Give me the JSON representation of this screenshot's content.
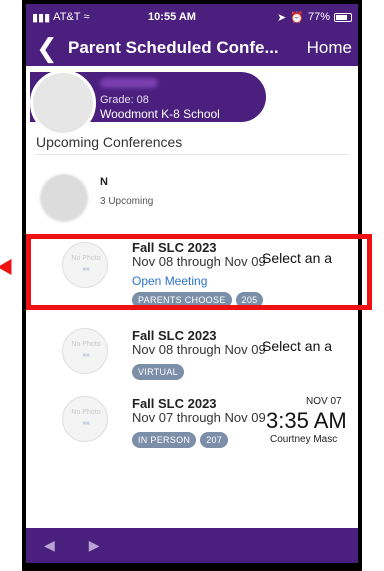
{
  "status_bar": {
    "carrier": "AT&T",
    "time": "10:55 AM",
    "battery": "77%"
  },
  "nav": {
    "title": "Parent Scheduled Confe...",
    "home_label": "Home"
  },
  "student": {
    "grade": "Grade: 08",
    "school": "Woodmont K-8 School"
  },
  "section": {
    "title": "Upcoming Conferences"
  },
  "teacher": {
    "initial": "N",
    "upcoming": "3 Upcoming"
  },
  "conferences": [
    {
      "photo": "No Photo",
      "title": "Fall SLC 2023",
      "dates": "Nov 08 through Nov 09",
      "action": "Select an a",
      "link": "Open Meeting",
      "tags": [
        "PARENTS CHOOSE",
        "205"
      ]
    },
    {
      "photo": "No Photo",
      "title": "Fall SLC 2023",
      "dates": "Nov 08 through Nov 09",
      "action": "Select an a",
      "tags": [
        "VIRTUAL"
      ]
    },
    {
      "photo": "No Photo",
      "title": "Fall SLC 2023",
      "dates": "Nov 07 through Nov 09",
      "right_date": "NOV 07",
      "right_time": "3:35 AM",
      "right_name": "Courtney Masc",
      "tags": [
        "IN PERSON",
        "207"
      ]
    }
  ],
  "colors": {
    "primary": "#4b1f7e",
    "tag": "#7b8fa8",
    "link": "#2e73c9",
    "highlight": "#ee1111"
  }
}
